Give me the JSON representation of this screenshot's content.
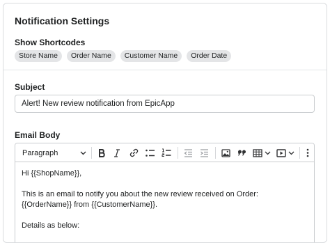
{
  "header": {
    "title": "Notification Settings"
  },
  "shortcodes": {
    "label": "Show Shortcodes",
    "items": [
      "Store Name",
      "Order Name",
      "Customer Name",
      "Order Date"
    ]
  },
  "subject": {
    "label": "Subject",
    "value": "Alert! New review notification from EpicApp"
  },
  "email_body": {
    "label": "Email Body",
    "toolbar": {
      "format_select": "Paragraph",
      "icons": [
        "bold-icon",
        "italic-icon",
        "link-icon",
        "bulleted-list-icon",
        "numbered-list-icon",
        "outdent-icon",
        "indent-icon",
        "image-icon",
        "blockquote-icon",
        "table-icon",
        "media-icon",
        "more-icon"
      ]
    },
    "content": {
      "line1": "Hi {{ShopName}},",
      "line2": "This is an email to notify you about the new review received on Order: {{OrderName}} from {{CustomerName}}.",
      "line3": "Details as below:"
    }
  },
  "colors": {
    "border": "#c9cccf",
    "chip_bg": "#e4e5e7",
    "text": "#202223",
    "icon": "#303133"
  }
}
